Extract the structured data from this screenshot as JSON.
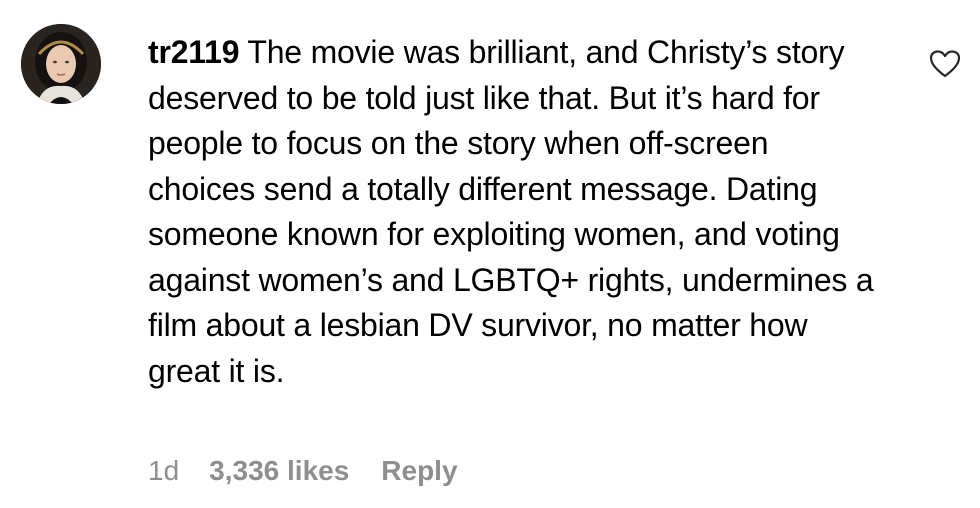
{
  "comment": {
    "username": "tr2119",
    "text": "The movie was brilliant, and Christy’s story deserved to be told just like that. But it’s hard for people to focus on the story when off-screen choices send a totally different message. Dating someone known for exploiting women, and voting against women’s and LGBTQ+ rights, undermines a film about a lesbian DV survivor, no matter how great it is.",
    "timestamp": "1d",
    "likes": "3,336 likes",
    "reply_label": "Reply",
    "like_icon": "heart-outline-icon",
    "avatar_icon": "portrait-avatar"
  },
  "colors": {
    "text": "#000000",
    "meta": "#8e8e8e",
    "background": "#ffffff"
  }
}
